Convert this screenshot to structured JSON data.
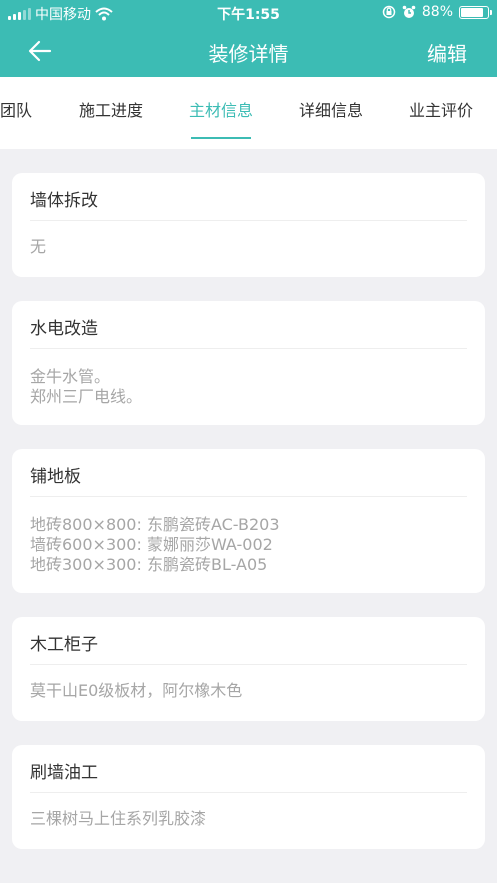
{
  "status_bar": {
    "carrier": "中国移动",
    "time": "下午1:55",
    "battery": "88%",
    "battery_level": 0.88,
    "icons": [
      "signal-icon",
      "wifi-icon",
      "rotation-lock-icon",
      "alarm-icon",
      "battery-icon"
    ]
  },
  "header": {
    "back_icon": "arrow-left-icon",
    "title": "装修详情",
    "edit_label": "编辑",
    "color": "#3cbcb4"
  },
  "tabs": [
    {
      "label": "团队",
      "active": false
    },
    {
      "label": "施工进度",
      "active": false
    },
    {
      "label": "主材信息",
      "active": true
    },
    {
      "label": "详细信息",
      "active": false
    },
    {
      "label": "业主评价",
      "active": false
    }
  ],
  "sections": [
    {
      "title": "墙体拆改",
      "lines": [
        "无"
      ]
    },
    {
      "title": "水电改造",
      "lines": [
        "金牛水管。",
        "郑州三厂电线。"
      ]
    },
    {
      "title": "铺地板",
      "lines": [
        "地砖800×800: 东鹏瓷砖AC-B203",
        "墙砖600×300: 蒙娜丽莎WA-002",
        "地砖300×300: 东鹏瓷砖BL-A05"
      ]
    },
    {
      "title": "木工柜子",
      "lines": [
        "莫干山E0级板材，阿尔橡木色"
      ]
    },
    {
      "title": "刷墙油工",
      "lines": [
        "三棵树马上住系列乳胶漆"
      ]
    }
  ]
}
